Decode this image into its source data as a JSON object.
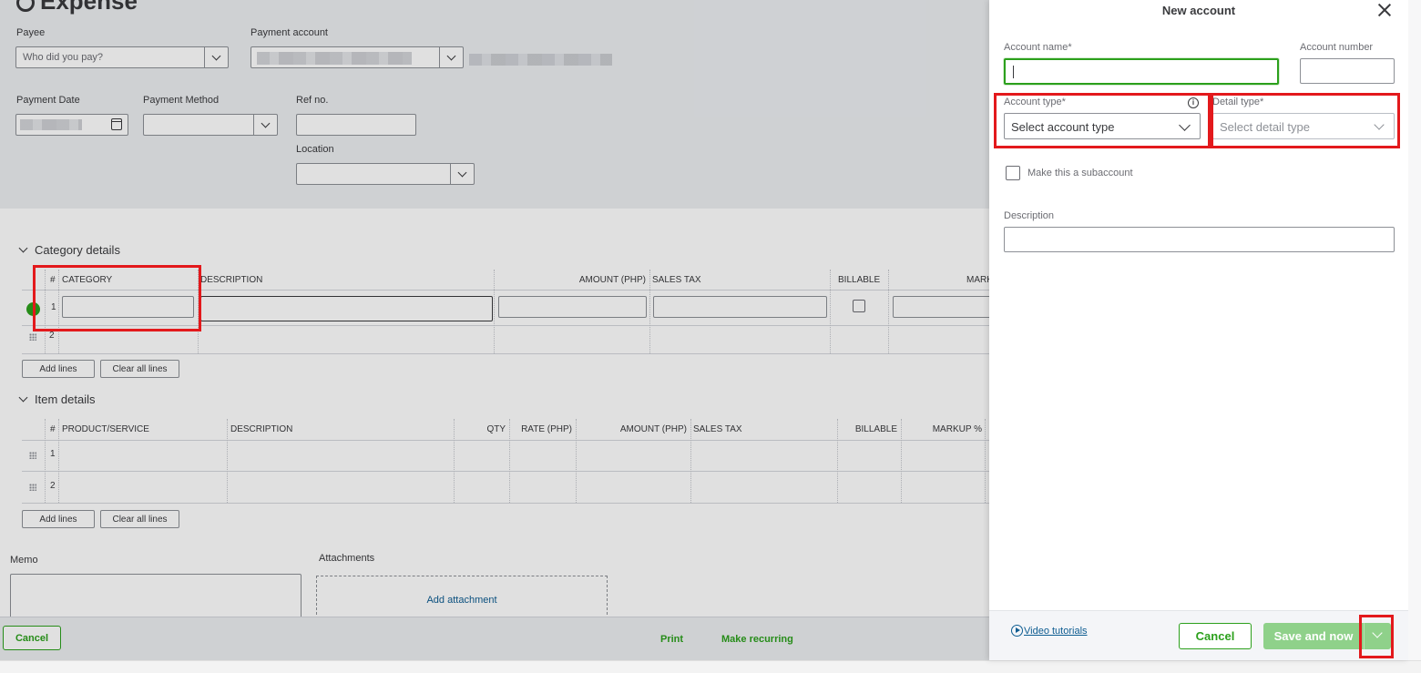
{
  "main": {
    "title": "Expense",
    "payee": {
      "label": "Payee",
      "placeholder": "Who did you pay?"
    },
    "payment_account": {
      "label": "Payment account"
    },
    "payment_date": {
      "label": "Payment Date"
    },
    "payment_method": {
      "label": "Payment Method"
    },
    "ref_no": {
      "label": "Ref no."
    },
    "location": {
      "label": "Location"
    },
    "category_details": {
      "title": "Category details",
      "columns": [
        "#",
        "CATEGORY",
        "DESCRIPTION",
        "AMOUNT (PHP)",
        "SALES TAX",
        "BILLABLE",
        "MARK"
      ],
      "rows": [
        "1",
        "2"
      ],
      "add_lines": "Add lines",
      "clear_all_lines": "Clear all lines"
    },
    "item_details": {
      "title": "Item details",
      "columns": [
        "#",
        "PRODUCT/SERVICE",
        "DESCRIPTION",
        "QTY",
        "RATE (PHP)",
        "AMOUNT (PHP)",
        "SALES TAX",
        "BILLABLE",
        "MARKUP %"
      ],
      "rows": [
        "1",
        "2"
      ],
      "add_lines": "Add lines",
      "clear_all_lines": "Clear all lines"
    },
    "memo_label": "Memo",
    "attachments_label": "Attachments",
    "add_attachment": "Add attachment",
    "footer": {
      "cancel": "Cancel",
      "print": "Print",
      "make_recurring": "Make recurring"
    }
  },
  "panel": {
    "title": "New account",
    "account_name_label": "Account name*",
    "account_number_label": "Account number",
    "account_type_label": "Account type*",
    "account_type_placeholder": "Select account type",
    "detail_type_label": "Detail type*",
    "detail_type_placeholder": "Select detail type",
    "subaccount_label": "Make this a subaccount",
    "description_label": "Description",
    "video_tutorials": "Video tutorials",
    "cancel": "Cancel",
    "save_and_new": "Save and now"
  },
  "colors": {
    "accent": "#2ca01c",
    "highlight": "#e3191c",
    "link": "#0d5c91"
  }
}
